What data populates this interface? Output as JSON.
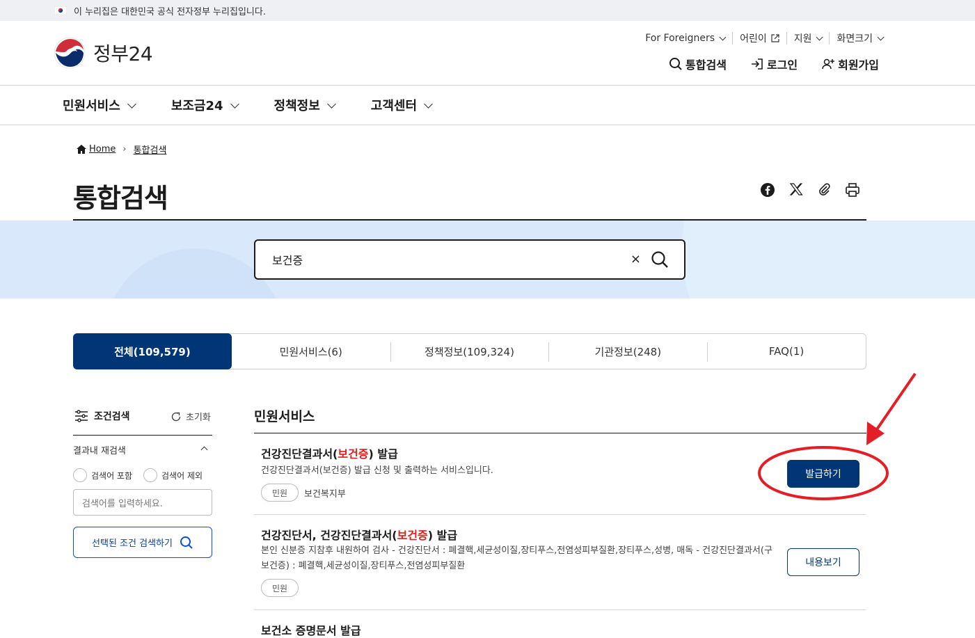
{
  "banner": {
    "text": "이 누리집은 대한민국 공식 전자정부 누리집입니다."
  },
  "logo": {
    "text": "정부24"
  },
  "util": [
    "For Foreigners",
    "어린이",
    "지원",
    "화면크기"
  ],
  "actions": {
    "search": "통합검색",
    "login": "로그인",
    "signup": "회원가입"
  },
  "gnb": [
    "민원서비스",
    "보조금24",
    "정책정보",
    "고객센터"
  ],
  "breadcrumb": {
    "home": "Home",
    "current": "통합검색"
  },
  "page_title": "통합검색",
  "search": {
    "value": "보건증",
    "clear": "×"
  },
  "tabs": [
    "전체(109,579)",
    "민원서비스(6)",
    "정책정보(109,324)",
    "기관정보(248)",
    "FAQ(1)"
  ],
  "filter": {
    "title": "조건검색",
    "reset": "초기화",
    "refine_label": "결과내 재검색",
    "include": "검색어 포함",
    "exclude": "검색어 제외",
    "placeholder": "검색어를 입력하세요.",
    "submit": "선택된 조건 검색하기"
  },
  "section_title": "민원서비스",
  "results": [
    {
      "title_pre": "건강진단결과서(",
      "title_hl": "보건증",
      "title_post": ") 발급",
      "desc": "건강진단결과서(보건증) 발급 신청 및 출력하는 서비스입니다.",
      "chip": "민원",
      "org": "보건복지부",
      "button": "발급하기"
    },
    {
      "title_pre": "건강진단서, 건강진단결과서(",
      "title_hl": "보건증",
      "title_post": ") 발급",
      "desc": "본인 신분증 지참후 내원하여 검사 - 건강진단서 : 폐결핵,세균성이질,장티푸스,전염성피부질환,장티푸스,성병, 매독 - 건강진단결과서(구 보건증) : 폐결핵,세균성이질,장티푸스,전염성피부질환",
      "chip": "민원",
      "button": "내용보기"
    },
    {
      "title_pre": "보건소 증명문서 발급"
    }
  ],
  "colors": {
    "primary": "#003675",
    "highlight": "#e21b1b",
    "band": "#d9e9fb",
    "annotation": "#e31e24"
  }
}
